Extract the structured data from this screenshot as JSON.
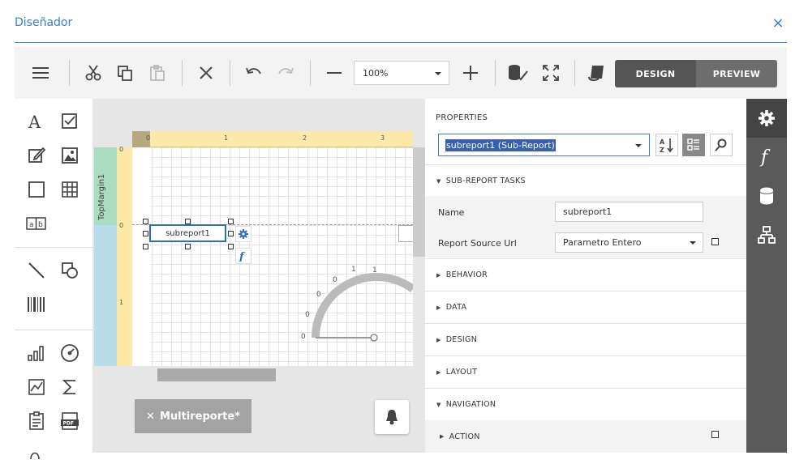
{
  "dialog": {
    "title": "Diseñador",
    "close": "×"
  },
  "toolbar": {
    "zoom_value": "100%",
    "design_label": "DESIGN",
    "preview_label": "PREVIEW"
  },
  "canvas": {
    "band_label": "TopMargin1",
    "ruler_top_ticks": [
      "0",
      "1",
      "2",
      "3"
    ],
    "ruler_left_ticks": [
      "0",
      "0",
      "1"
    ],
    "subreport_label": "subreport1",
    "gauge_labels": [
      "0",
      "0",
      "0",
      "0",
      "1",
      "1"
    ],
    "tab_label": "Multireporte*",
    "tab_close": "✕"
  },
  "properties": {
    "title": "PROPERTIES",
    "selected_component": "subreport1 (Sub-Report)",
    "sections": {
      "sub_report_tasks": "SUB-REPORT TASKS",
      "behavior": "BEHAVIOR",
      "data": "DATA",
      "design": "DESIGN",
      "layout": "LAYOUT",
      "navigation": "NAVIGATION",
      "action": "ACTION"
    },
    "fields": {
      "name_label": "Name",
      "name_value": "subreport1",
      "source_label": "Report Source Url",
      "source_value": "Parametro Entero"
    }
  },
  "icons": {
    "menu": "menu-icon",
    "cut": "scissors-icon",
    "copy": "copy-icon",
    "paste": "paste-icon",
    "delete": "close-icon",
    "undo": "undo-icon",
    "redo": "redo-icon",
    "zoom_out": "minus-icon",
    "zoom_in": "plus-icon",
    "validate": "database-check-icon",
    "fullscreen": "fullscreen-icon",
    "scripts": "scroll-icon",
    "properties": "gear-icon",
    "expressions": "function-icon",
    "field_list": "database-icon",
    "report_explorer": "hierarchy-icon"
  },
  "colors": {
    "accent": "#3a7bd5",
    "mode_active": "#555555",
    "side_panel": "#5a5a5a"
  }
}
